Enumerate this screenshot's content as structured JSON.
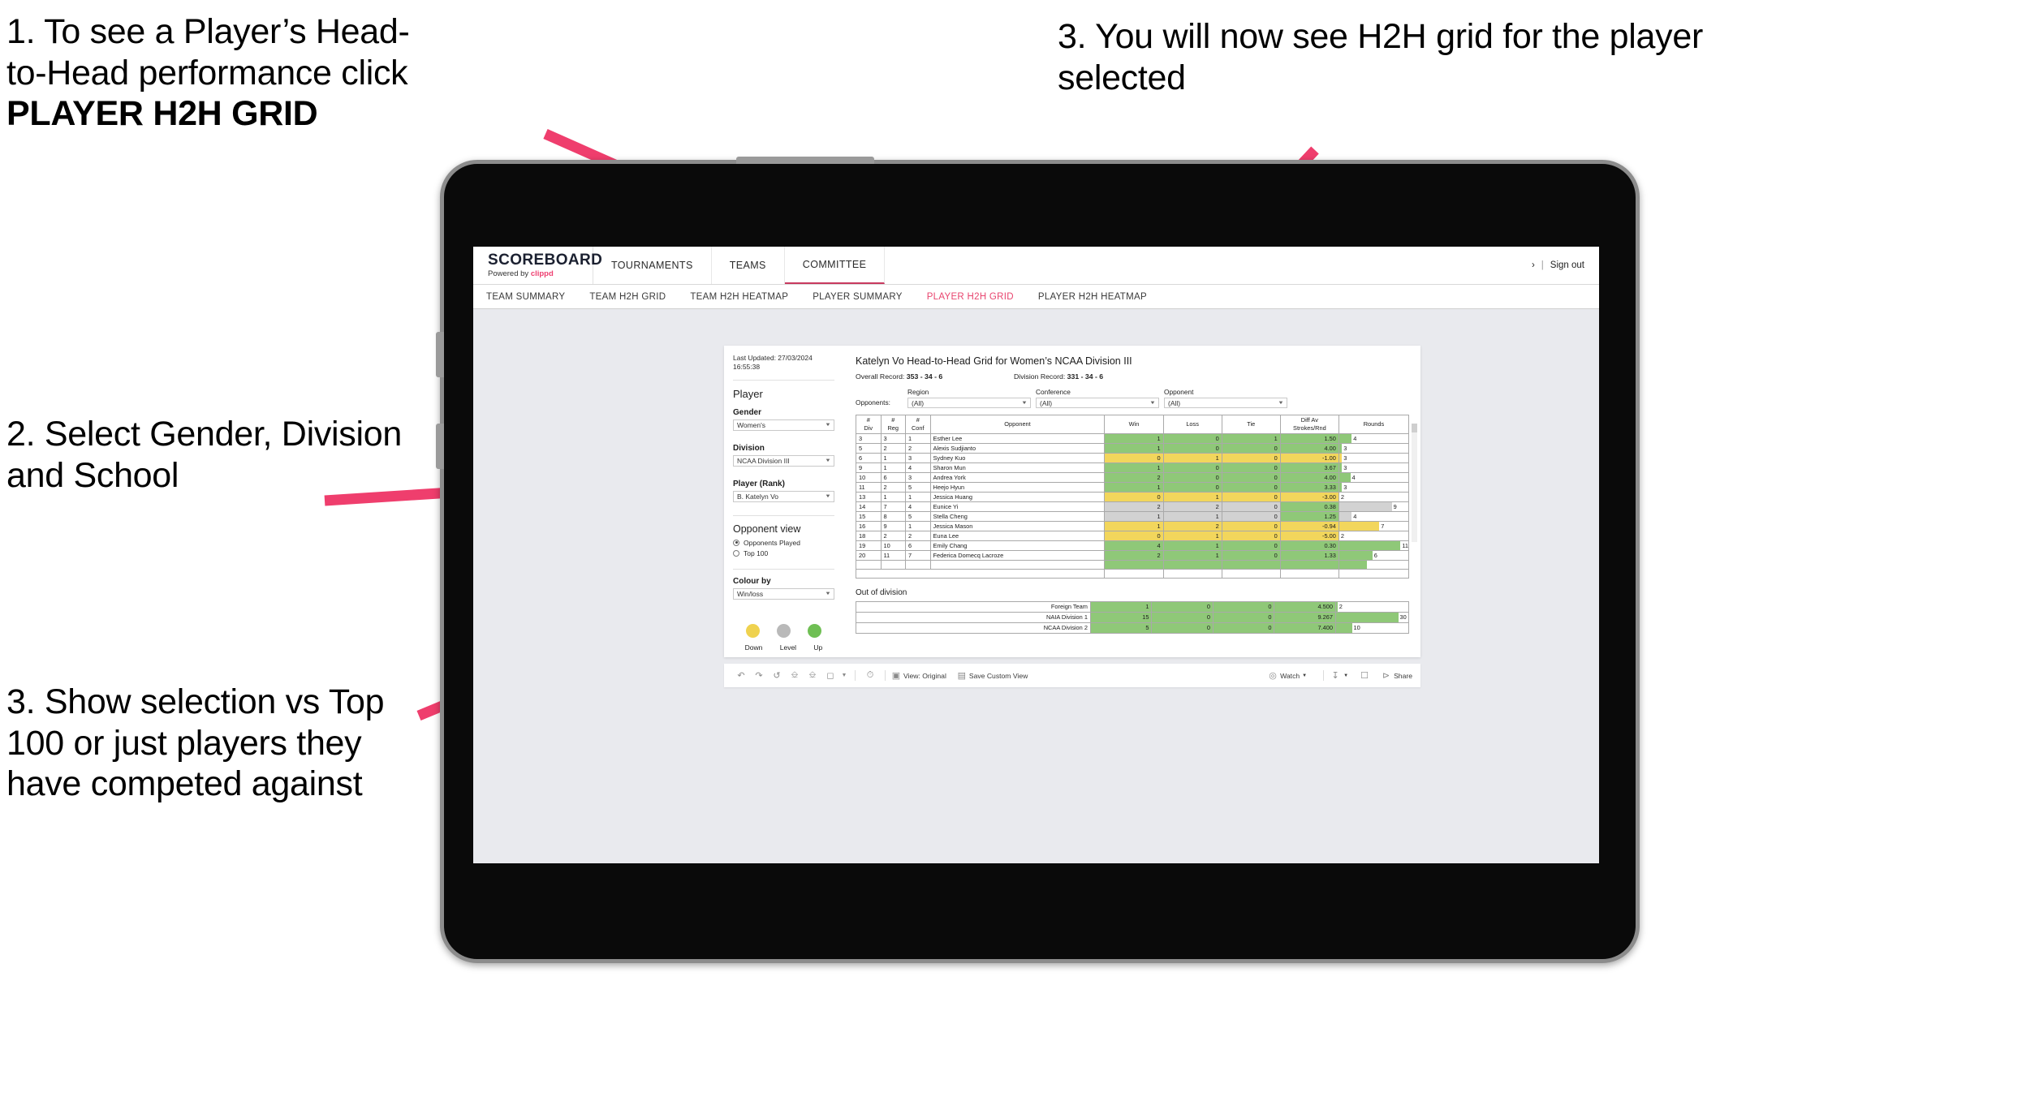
{
  "annotations": [
    {
      "id": 1,
      "line1": "1. To see a Player’s Head-",
      "line2": "to-Head performance click",
      "line3": "PLAYER H2H GRID"
    },
    {
      "id": 2,
      "text": "2. Select Gender, Division and School"
    },
    {
      "id": 3,
      "text": "3. Show selection vs Top 100 or just players they have competed against"
    },
    {
      "id": 4,
      "text": "3. You will now see H2H grid for the player selected"
    }
  ],
  "colors": {
    "accent_pink": "#e8446e",
    "brand_pink": "#ee3f70",
    "win_green": "#8fc878",
    "loss_yellow": "#f2d65c",
    "tie_grey": "#d2d2d2",
    "desktop_bg": "#e9eaee"
  },
  "app": {
    "brand": {
      "title": "SCOREBOARD",
      "powered_prefix": "Powered by",
      "powered_name": "clippd"
    },
    "top_nav": [
      {
        "label": "TOURNAMENTS",
        "active": false
      },
      {
        "label": "TEAMS",
        "active": false
      },
      {
        "label": "COMMITTEE",
        "active": true
      }
    ],
    "top_right": {
      "chevron": "›",
      "separator": "|",
      "sign_out": "Sign out"
    },
    "sub_nav": [
      {
        "label": "TEAM SUMMARY",
        "active": false
      },
      {
        "label": "TEAM H2H GRID",
        "active": false
      },
      {
        "label": "TEAM H2H HEATMAP",
        "active": false
      },
      {
        "label": "PLAYER SUMMARY",
        "active": false
      },
      {
        "label": "PLAYER H2H GRID",
        "active": true
      },
      {
        "label": "PLAYER H2H HEATMAP",
        "active": false
      }
    ]
  },
  "sidebar": {
    "last_updated": "Last Updated: 27/03/2024 16:55:38",
    "player_heading": "Player",
    "gender": {
      "label": "Gender",
      "value": "Women's"
    },
    "division": {
      "label": "Division",
      "value": "NCAA Division III"
    },
    "player_rank": {
      "label": "Player (Rank)",
      "value": "B. Katelyn Vo"
    },
    "opponent_view": {
      "heading": "Opponent view",
      "options": [
        {
          "label": "Opponents Played",
          "selected": true
        },
        {
          "label": "Top 100",
          "selected": false
        }
      ]
    },
    "colour_by": {
      "label": "Colour by",
      "value": "Win/loss"
    },
    "legend": [
      {
        "label": "Down",
        "color": "#efd24f"
      },
      {
        "label": "Level",
        "color": "#b9b9b9"
      },
      {
        "label": "Up",
        "color": "#6fbf54"
      }
    ]
  },
  "main": {
    "title": "Katelyn Vo Head-to-Head Grid for Women’s NCAA Division III",
    "overall_record_label": "Overall Record:",
    "overall_record_value": "353 - 34 - 6",
    "division_record_label": "Division Record:",
    "division_record_value": "331 - 34 - 6",
    "opponents_label": "Opponents:",
    "filters": [
      {
        "caption": "Region",
        "value": "(All)"
      },
      {
        "caption": "Conference",
        "value": "(All)"
      },
      {
        "caption": "Opponent",
        "value": "(All)"
      }
    ],
    "table": {
      "headers": [
        "# Div",
        "# Reg",
        "# Conf",
        "Opponent",
        "Win",
        "Loss",
        "Tie",
        "Diff Av Strokes/Rnd",
        "Rounds"
      ],
      "header_lines": [
        [
          "#",
          "Div"
        ],
        [
          "#",
          "Reg"
        ],
        [
          "#",
          "Conf"
        ],
        [
          "Opponent",
          ""
        ],
        [
          "Win",
          ""
        ],
        [
          "Loss",
          ""
        ],
        [
          "Tie",
          ""
        ],
        [
          "Diff Av",
          "Strokes/Rnd"
        ],
        [
          "Rounds",
          ""
        ]
      ],
      "rows": [
        {
          "div": "3",
          "reg": "3",
          "conf": "1",
          "opponent": "Esther Lee",
          "win": "1",
          "loss": "0",
          "tie": "1",
          "diff": "1.50",
          "rounds": "4",
          "rounds_pct": 18,
          "fill": "#8fc878",
          "tiefill": "#8fc878"
        },
        {
          "div": "5",
          "reg": "2",
          "conf": "2",
          "opponent": "Alexis Sudjianto",
          "win": "1",
          "loss": "0",
          "tie": "0",
          "diff": "4.00",
          "rounds": "3",
          "rounds_pct": 4,
          "fill": "#8fc878",
          "tiefill": "#8fc878"
        },
        {
          "div": "6",
          "reg": "1",
          "conf": "3",
          "opponent": "Sydney Kuo",
          "win": "0",
          "loss": "1",
          "tie": "0",
          "diff": "-1.00",
          "rounds": "3",
          "rounds_pct": 4,
          "fill": "#f2d65c",
          "tiefill": "#f2d65c"
        },
        {
          "div": "9",
          "reg": "1",
          "conf": "4",
          "opponent": "Sharon Mun",
          "win": "1",
          "loss": "0",
          "tie": "0",
          "diff": "3.67",
          "rounds": "3",
          "rounds_pct": 4,
          "fill": "#8fc878",
          "tiefill": "#8fc878"
        },
        {
          "div": "10",
          "reg": "6",
          "conf": "3",
          "opponent": "Andrea York",
          "win": "2",
          "loss": "0",
          "tie": "0",
          "diff": "4.00",
          "rounds": "4",
          "rounds_pct": 16,
          "fill": "#8fc878",
          "tiefill": "#8fc878"
        },
        {
          "div": "11",
          "reg": "2",
          "conf": "5",
          "opponent": "Heejo Hyun",
          "win": "1",
          "loss": "0",
          "tie": "0",
          "diff": "3.33",
          "rounds": "3",
          "rounds_pct": 4,
          "fill": "#8fc878",
          "tiefill": "#8fc878"
        },
        {
          "div": "13",
          "reg": "1",
          "conf": "1",
          "opponent": "Jessica Huang",
          "win": "0",
          "loss": "1",
          "tie": "0",
          "diff": "-3.00",
          "rounds": "2",
          "rounds_pct": 0,
          "fill": "#f2d65c",
          "tiefill": "#f2d65c"
        },
        {
          "div": "14",
          "reg": "7",
          "conf": "4",
          "opponent": "Eunice Yi",
          "win": "2",
          "loss": "2",
          "tie": "0",
          "diff": "0.38",
          "rounds": "9",
          "rounds_pct": 76,
          "fill": "#d2d2d2",
          "tiefill": "#8fc878"
        },
        {
          "div": "15",
          "reg": "8",
          "conf": "5",
          "opponent": "Stella Cheng",
          "win": "1",
          "loss": "1",
          "tie": "0",
          "diff": "1.25",
          "rounds": "4",
          "rounds_pct": 18,
          "fill": "#d2d2d2",
          "tiefill": "#8fc878"
        },
        {
          "div": "16",
          "reg": "9",
          "conf": "1",
          "opponent": "Jessica Mason",
          "win": "1",
          "loss": "2",
          "tie": "0",
          "diff": "-0.94",
          "rounds": "7",
          "rounds_pct": 58,
          "fill": "#f2d65c",
          "tiefill": "#f2d65c"
        },
        {
          "div": "18",
          "reg": "2",
          "conf": "2",
          "opponent": "Euna Lee",
          "win": "0",
          "loss": "1",
          "tie": "0",
          "diff": "-5.00",
          "rounds": "2",
          "rounds_pct": 0,
          "fill": "#f2d65c",
          "tiefill": "#f2d65c"
        },
        {
          "div": "19",
          "reg": "10",
          "conf": "6",
          "opponent": "Emily Chang",
          "win": "4",
          "loss": "1",
          "tie": "0",
          "diff": "0.30",
          "rounds": "11",
          "rounds_pct": 92,
          "fill": "#8fc878",
          "tiefill": "#8fc878"
        },
        {
          "div": "20",
          "reg": "11",
          "conf": "7",
          "opponent": "Federica Domecq Lacroze",
          "win": "2",
          "loss": "1",
          "tie": "0",
          "diff": "1.33",
          "rounds": "6",
          "rounds_pct": 48,
          "fill": "#8fc878",
          "tiefill": "#8fc878"
        }
      ]
    },
    "out_of_division": {
      "title": "Out of division",
      "rows": [
        {
          "label": "Foreign Team",
          "win": "1",
          "loss": "0",
          "tie": "0",
          "diff": "4.500",
          "rounds": "2",
          "rounds_pct": 2,
          "fill": "#8fc878"
        },
        {
          "label": "NAIA Division 1",
          "win": "15",
          "loss": "0",
          "tie": "0",
          "diff": "9.267",
          "rounds": "30",
          "rounds_pct": 86,
          "fill": "#8fc878"
        },
        {
          "label": "NCAA Division 2",
          "win": "5",
          "loss": "0",
          "tie": "0",
          "diff": "7.400",
          "rounds": "10",
          "rounds_pct": 22,
          "fill": "#8fc878"
        }
      ]
    }
  },
  "toolbar": {
    "icons": [
      "undo-icon",
      "redo-icon",
      "revert-icon",
      "refresh-icon",
      "pause-icon",
      "highlight-icon",
      "dropdown-caret-icon",
      "clock-icon"
    ],
    "view_original": "View: Original",
    "save_custom_view": "Save Custom View",
    "watch": "Watch",
    "share": "Share"
  },
  "chart_data": {
    "type": "table",
    "title": "Katelyn Vo Head-to-Head Grid for Women’s NCAA Division III",
    "columns": [
      "# Div",
      "# Reg",
      "# Conf",
      "Opponent",
      "Win",
      "Loss",
      "Tie",
      "Diff Av Strokes/Rnd",
      "Rounds"
    ],
    "rows": [
      [
        "3",
        "3",
        "1",
        "Esther Lee",
        1,
        0,
        1,
        1.5,
        4
      ],
      [
        "5",
        "2",
        "2",
        "Alexis Sudjianto",
        1,
        0,
        0,
        4.0,
        3
      ],
      [
        "6",
        "1",
        "3",
        "Sydney Kuo",
        0,
        1,
        0,
        -1.0,
        3
      ],
      [
        "9",
        "1",
        "4",
        "Sharon Mun",
        1,
        0,
        0,
        3.67,
        3
      ],
      [
        "10",
        "6",
        "3",
        "Andrea York",
        2,
        0,
        0,
        4.0,
        4
      ],
      [
        "11",
        "2",
        "5",
        "Heejo Hyun",
        1,
        0,
        0,
        3.33,
        3
      ],
      [
        "13",
        "1",
        "1",
        "Jessica Huang",
        0,
        1,
        0,
        -3.0,
        2
      ],
      [
        "14",
        "7",
        "4",
        "Eunice Yi",
        2,
        2,
        0,
        0.38,
        9
      ],
      [
        "15",
        "8",
        "5",
        "Stella Cheng",
        1,
        1,
        0,
        1.25,
        4
      ],
      [
        "16",
        "9",
        "1",
        "Jessica Mason",
        1,
        2,
        0,
        -0.94,
        7
      ],
      [
        "18",
        "2",
        "2",
        "Euna Lee",
        0,
        1,
        0,
        -5.0,
        2
      ],
      [
        "19",
        "10",
        "6",
        "Emily Chang",
        4,
        1,
        0,
        0.3,
        11
      ],
      [
        "20",
        "11",
        "7",
        "Federica Domecq Lacroze",
        2,
        1,
        0,
        1.33,
        6
      ]
    ],
    "out_of_division_rows": [
      [
        "Foreign Team",
        1,
        0,
        0,
        4.5,
        2
      ],
      [
        "NAIA Division 1",
        15,
        0,
        0,
        9.267,
        30
      ],
      [
        "NCAA Division 2",
        5,
        0,
        0,
        7.4,
        10
      ]
    ],
    "summary": {
      "overall_record": "353 - 34 - 6",
      "division_record": "331 - 34 - 6"
    },
    "legend": [
      "Down",
      "Level",
      "Up"
    ],
    "legend_position": "sidebar-bottom"
  }
}
